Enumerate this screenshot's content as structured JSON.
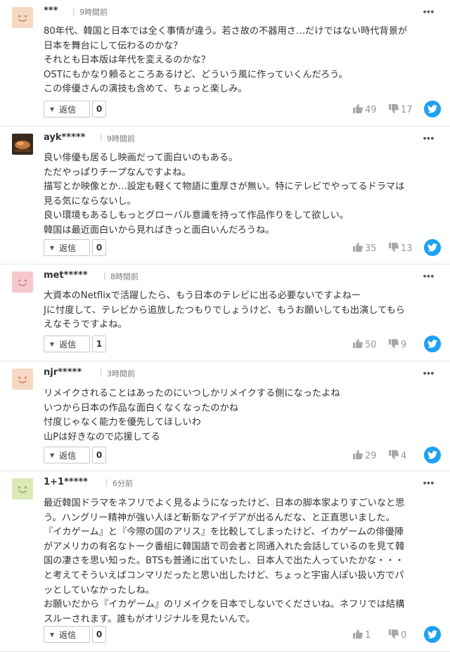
{
  "reply_label": "返信",
  "comments": [
    {
      "user": "***",
      "time": "9時間前",
      "lines": [
        "80年代、韓国と日本では全く事情が違う。若さ故の不器用さ…だけではない時代背景が",
        "日本を舞台にして伝わるのかな？",
        "それとも日本版は年代を変えるのかな？",
        "OSTにもかなり頼るところあるけど、どういう風に作っていくんだろう。",
        "この俳優さんの演技も含めて、ちょっと楽しみ。"
      ],
      "replies": "0",
      "likes": "49",
      "dislikes": "17",
      "avatar": {
        "kind": "face",
        "bg": "#f5d9c4",
        "fg": "#d98c5f"
      }
    },
    {
      "user": "ayk*****",
      "time": "9時間前",
      "lines": [
        "良い俳優も居るし映画だって面白いのもある。",
        "ただやっぱりチープなんですよね。",
        "描写とか映像とか…設定も軽くて物語に重厚さが無い。特にテレビでやってるドラマは",
        "見る気にならないし。",
        "良い環境もあるしもっとグローバル意識を持って作品作りをして欲しい。",
        "韓国は最近面白いから見ればきっと面白いんだろうね。"
      ],
      "replies": "0",
      "likes": "35",
      "dislikes": "13",
      "avatar": {
        "kind": "photo",
        "bg": "#3a2a1c",
        "fg": "#c0763a"
      }
    },
    {
      "user": "met*****",
      "time": "8時間前",
      "lines": [
        "大資本のNetflixで活躍したら、もう日本のテレビに出る必要ないですよねー",
        "Jに忖度して、テレビから追放したつもりでしょうけど、もうお願いしても出演してもら",
        "えなそうですよね。"
      ],
      "replies": "1",
      "likes": "50",
      "dislikes": "9",
      "avatar": {
        "kind": "face",
        "bg": "#f6c9cc",
        "fg": "#d9848b"
      }
    },
    {
      "user": "njr*****",
      "time": "3時間前",
      "lines": [
        "リメイクされることはあったのにいつしかリメイクする側になったよね",
        "いつから日本の作品な面白くなくなったのかね",
        "忖度じゃなく能力を優先してほしいわ",
        "山Pは好きなので応援してる"
      ],
      "replies": "0",
      "likes": "29",
      "dislikes": "4",
      "avatar": {
        "kind": "face",
        "bg": "#f5d9c4",
        "fg": "#d98c5f"
      }
    },
    {
      "user": "1+1*****",
      "time": "6分前",
      "lines": [
        "最近韓国ドラマをネフリでよく見るようになったけど、日本の脚本家よりすごいなと思",
        "う。ハングリー精神が強い人ほど斬新なアイデアが出るんだな、と正直思いました。",
        "『イカゲーム』と『今際の国のアリス』を比較してしまったけど、イカゲームの俳優陣",
        "がアメリカの有名なトーク番組に韓国語で司会者と同通入れた会話しているのを見て韓",
        "国の凄さを思い知った。BTSも普通に出ていたし、日本人で出た人っていたかな・・・",
        "と考えてそういえばコンマリだったと思い出したけど、ちょっと宇宙人ぽい扱い方でパ",
        "ッとしていなかったしね。",
        "お願いだから『イカゲーム』のリメイクを日本でしないでくださいね。ネフリでは結構",
        "スルーされます。誰もがオリジナルを見たいんで。"
      ],
      "replies": "0",
      "likes": "1",
      "dislikes": "0",
      "avatar": {
        "kind": "face",
        "bg": "#dbe8b8",
        "fg": "#9bb35e"
      }
    }
  ]
}
